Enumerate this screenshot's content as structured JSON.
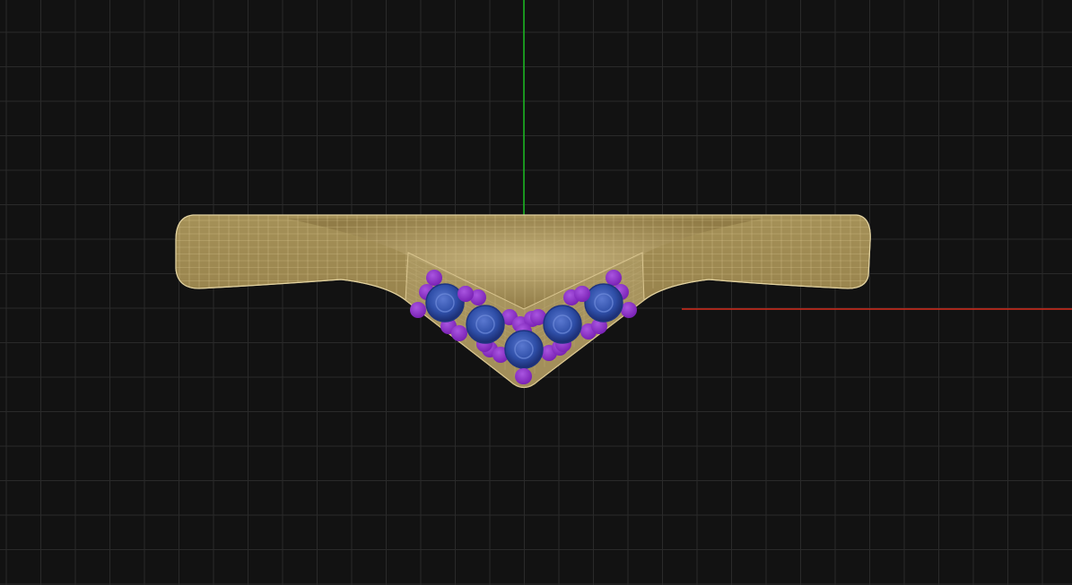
{
  "viewport": {
    "background_color": "#121212",
    "grid_color": "#2a2a2a",
    "x_axis_color": "#d42a1a",
    "y_axis_color": "#18c820"
  },
  "model": {
    "name": "",
    "object": "chevron-ring-wireframe",
    "metal_color": "#9a8550",
    "wire_color": "#d8c48e",
    "inner_surface_color": "#b4a26e"
  },
  "stones": {
    "main_stone_color": "#2f4fa8",
    "main_stone_rim": "#1e3480",
    "main_stone_count": 5,
    "accent_stone_color": "#8a2fc4",
    "accent_stone_count": 26
  }
}
